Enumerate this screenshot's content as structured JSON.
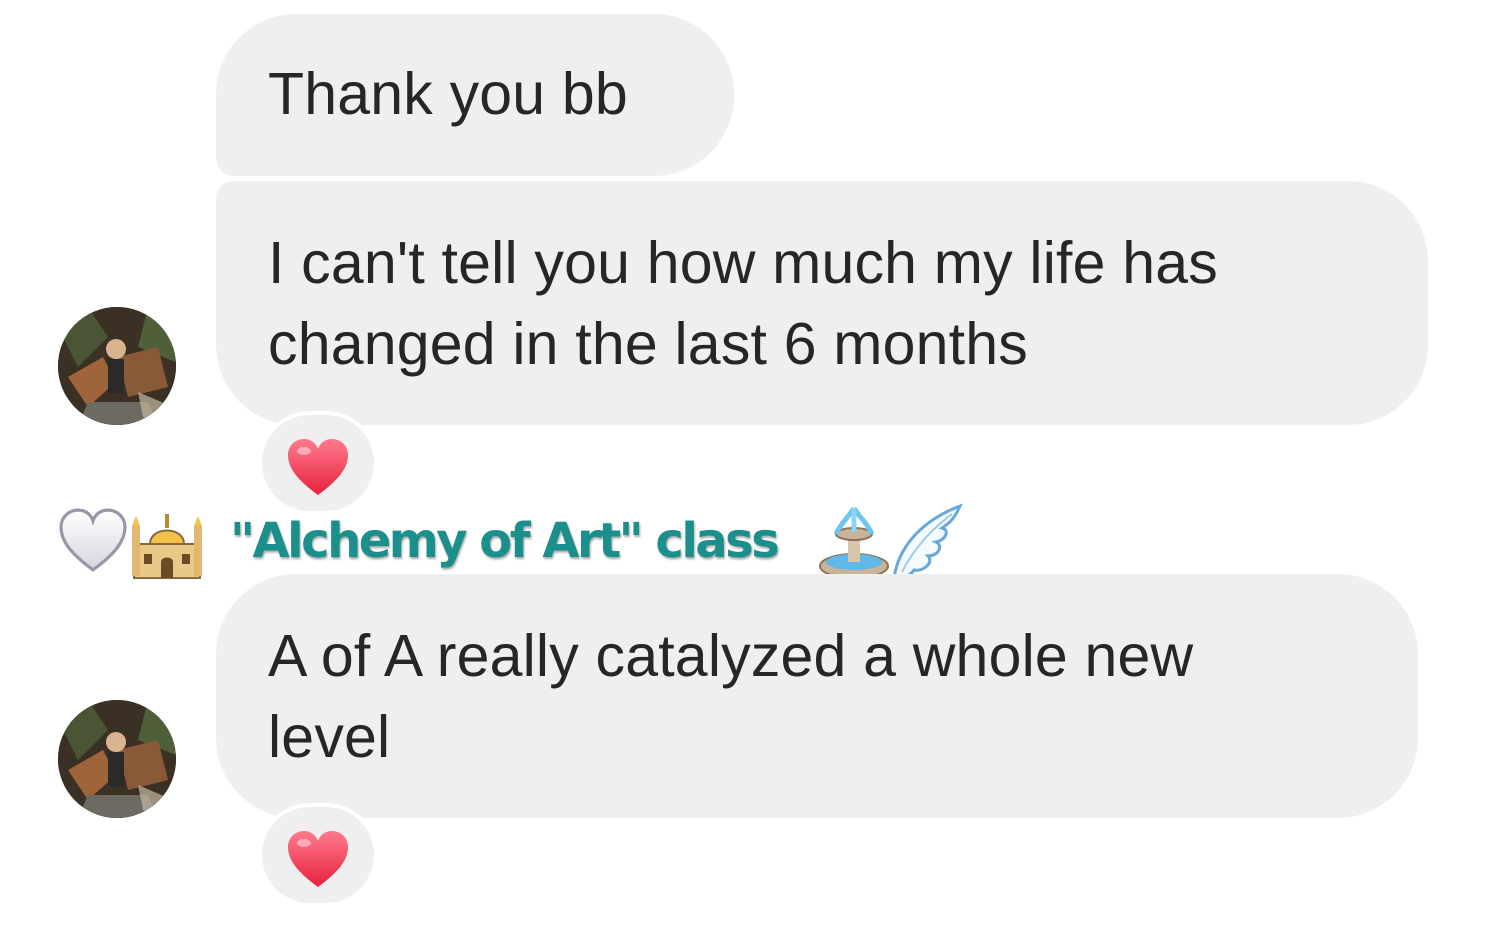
{
  "messages": [
    {
      "text": "Thank you bb"
    },
    {
      "text": "I can't tell you how much my life has\nchanged in the last 6 months",
      "reaction": "red-heart"
    },
    {
      "text": "A of A really catalyzed a whole new\nlevel",
      "reaction": "red-heart"
    }
  ],
  "sender": {
    "name": "\"Alchemy of Art\" class",
    "leading_icons": [
      "white-heart",
      "mosque"
    ],
    "trailing_icons": [
      "fountain",
      "wing"
    ]
  },
  "colors": {
    "bubble": "#efefef",
    "text": "#262626",
    "sender_name": "#1a8f8c",
    "heart": "#f0334f"
  }
}
